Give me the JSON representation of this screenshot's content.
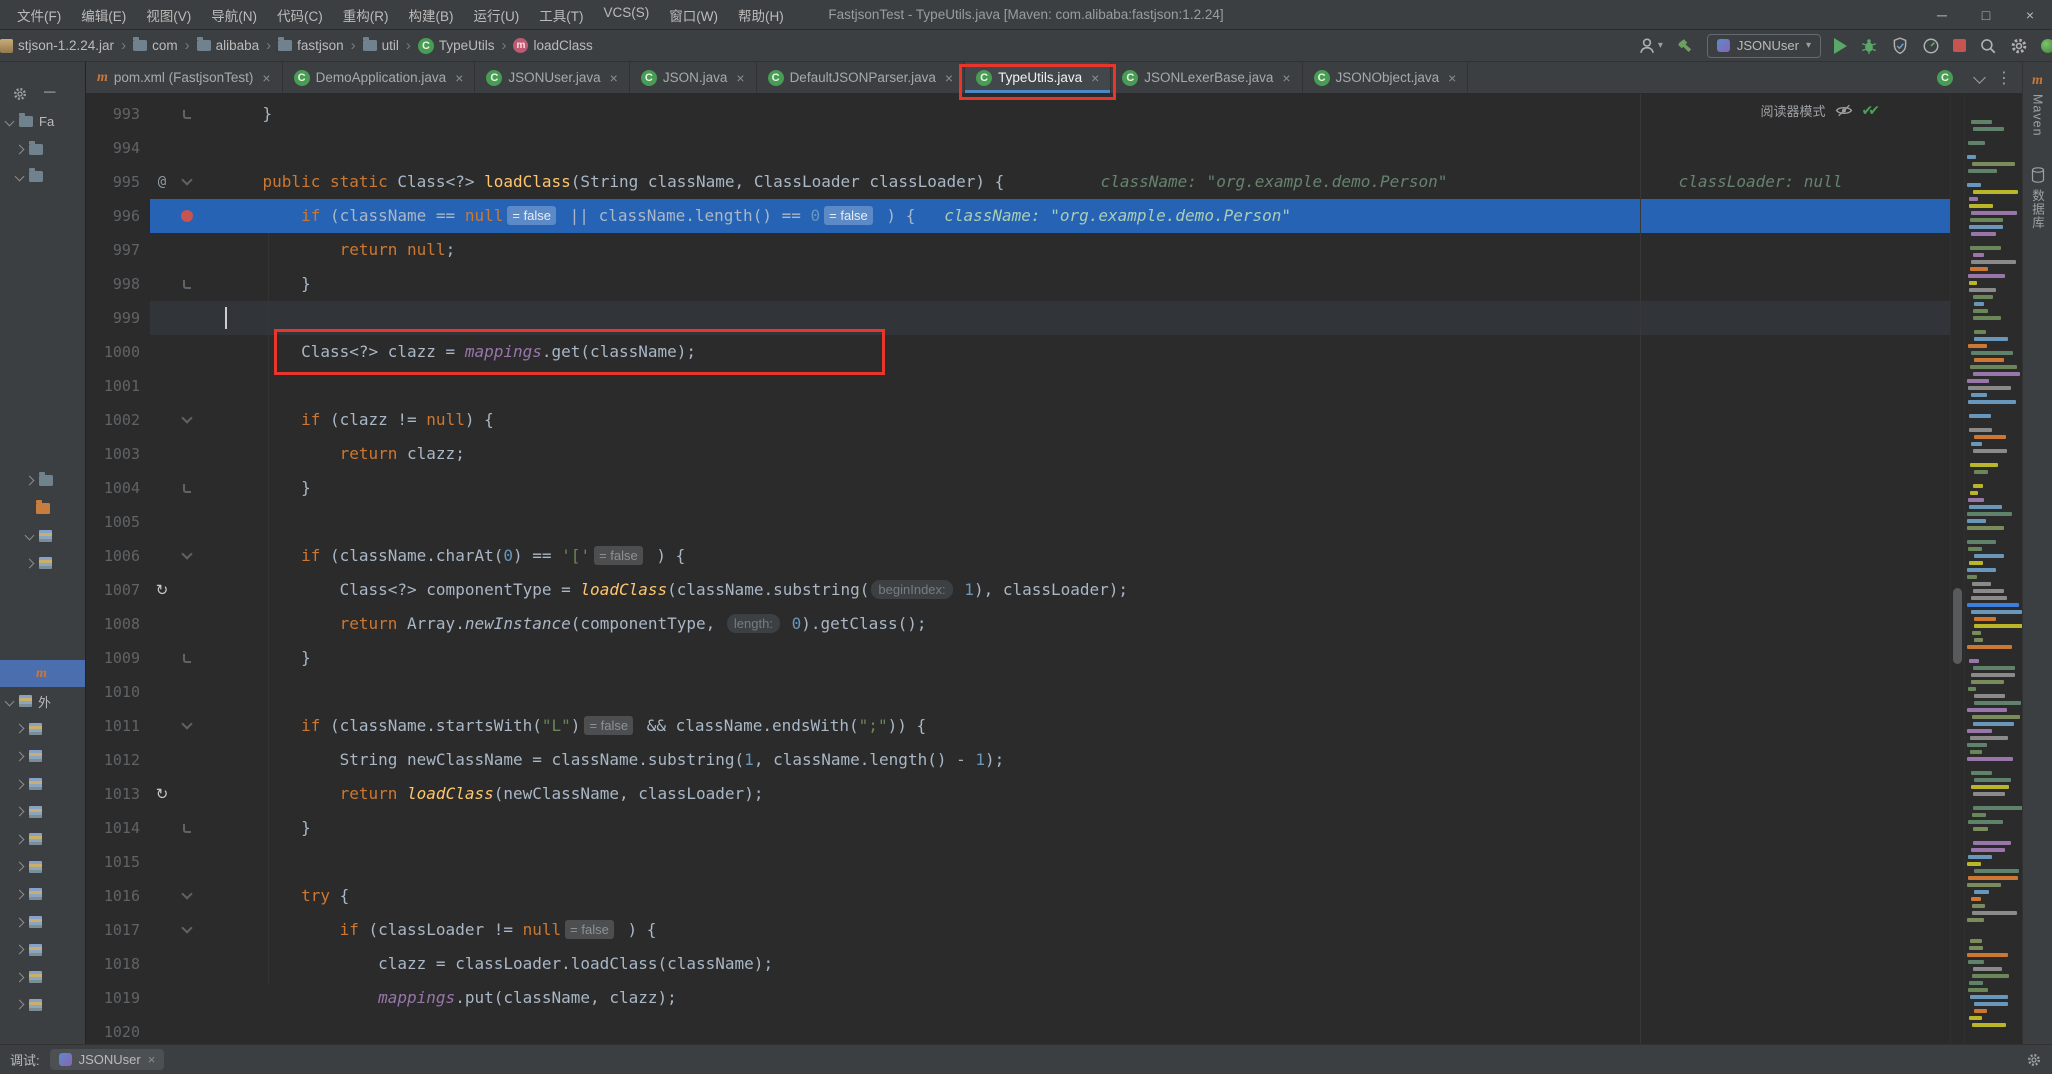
{
  "colors": {
    "annotation": "#E8362D",
    "exec_line": "#2663B5",
    "selection": "#4B6EAF",
    "accent_green": "#59A869",
    "stop_red": "#C75450"
  },
  "icons": {
    "close": "×",
    "chevron": "›",
    "dropdown": "▾",
    "kebab": "⋮",
    "minimize": "─",
    "maximize": "□",
    "close_window": "×",
    "at": "@",
    "recursion": "↻",
    "checks": "✔✔",
    "minus": "─"
  },
  "window": {
    "title": "FastjsonTest - TypeUtils.java [Maven: com.alibaba:fastjson:1.2.24]",
    "menus": [
      "文件(F)",
      "编辑(E)",
      "视图(V)",
      "导航(N)",
      "代码(C)",
      "重构(R)",
      "构建(B)",
      "运行(U)",
      "工具(T)",
      "VCS(S)",
      "窗口(W)",
      "帮助(H)"
    ],
    "controls": {
      "minimize": "─",
      "maximize": "□",
      "close": "×"
    }
  },
  "navbar": {
    "breadcrumbs": [
      {
        "label": "stjson-1.2.24.jar",
        "icon": "jar"
      },
      {
        "label": "com",
        "icon": "folder"
      },
      {
        "label": "alibaba",
        "icon": "folder"
      },
      {
        "label": "fastjson",
        "icon": "folder"
      },
      {
        "label": "util",
        "icon": "folder"
      },
      {
        "label": "TypeUtils",
        "icon": "class"
      },
      {
        "label": "loadClass",
        "icon": "method"
      }
    ],
    "run_config": "JSONUser"
  },
  "tabs": [
    {
      "label": "pom.xml (FastjsonTest)",
      "icon": "maven"
    },
    {
      "label": "DemoApplication.java",
      "icon": "class"
    },
    {
      "label": "JSONUser.java",
      "icon": "class"
    },
    {
      "label": "JSON.java",
      "icon": "class"
    },
    {
      "label": "DefaultJSONParser.java",
      "icon": "class"
    },
    {
      "label": "TypeUtils.java",
      "icon": "class",
      "selected": true,
      "annotated": true
    },
    {
      "label": "JSONLexerBase.java",
      "icon": "class"
    },
    {
      "label": "JSONObject.java",
      "icon": "class"
    }
  ],
  "reader_mode": {
    "label": "阅读器模式"
  },
  "project": {
    "rows": [
      {
        "ch": "v",
        "icon": "folder",
        "label": "Fa"
      },
      {
        "ch": ">",
        "icon": "folder",
        "ind": 1
      },
      {
        "ch": "v",
        "icon": "folder",
        "ind": 1
      },
      {},
      {},
      {},
      {},
      {},
      {},
      {},
      {},
      {},
      {},
      {
        "ch": ">",
        "icon": "folder",
        "ind": 2
      },
      {
        "icon": "folder-orange",
        "ind": 3
      },
      {
        "ch": "v",
        "icon": "lib",
        "ind": 2
      },
      {
        "ch": ">",
        "icon": "lib",
        "ind": 2
      },
      {},
      {},
      {},
      {
        "icon": "maven",
        "ind": 3,
        "sel": true
      },
      {
        "ch": "v",
        "icon": "lib",
        "label": "外"
      },
      {
        "ch": ">",
        "icon": "lib",
        "ind": 1
      },
      {
        "ch": ">",
        "icon": "lib",
        "ind": 1
      },
      {
        "ch": ">",
        "icon": "lib",
        "ind": 1
      },
      {
        "ch": ">",
        "icon": "lib",
        "ind": 1
      },
      {
        "ch": ">",
        "icon": "lib",
        "ind": 1
      },
      {
        "ch": ">",
        "icon": "lib",
        "ind": 1
      },
      {
        "ch": ">",
        "icon": "lib",
        "ind": 1
      },
      {
        "ch": ">",
        "icon": "lib",
        "ind": 1
      },
      {
        "ch": ">",
        "icon": "lib",
        "ind": 1
      },
      {
        "ch": ">",
        "icon": "lib",
        "ind": 1
      },
      {
        "ch": ">",
        "icon": "lib",
        "ind": 1
      }
    ]
  },
  "editor": {
    "exec_line": "996",
    "caret_line": "999",
    "lines": [
      {
        "no": "993",
        "g": "fold-end",
        "segs": [
          {
            "t": "    }",
            "c": "d"
          }
        ]
      },
      {
        "no": "994",
        "segs": []
      },
      {
        "no": "995",
        "g": "fold-open",
        "g2": "at",
        "segs": [
          {
            "t": "    ",
            "c": "d"
          },
          {
            "t": "public",
            "c": "k"
          },
          {
            "t": " ",
            "c": "d"
          },
          {
            "t": "static",
            "c": "k"
          },
          {
            "t": " Class<?> ",
            "c": "d"
          },
          {
            "t": "loadClass",
            "c": "m"
          },
          {
            "t": "(String className, ClassLoader classLoader) {",
            "c": "d"
          },
          {
            "t": "          className: \"org.example.demo.Person\"",
            "c": "dbg"
          },
          {
            "t": "                        classLoader: null",
            "c": "dbg"
          }
        ]
      },
      {
        "no": "996",
        "g": "breakpoint",
        "exec": true,
        "segs": [
          {
            "t": "        ",
            "c": "d"
          },
          {
            "t": "if",
            "c": "k"
          },
          {
            "t": " (className == ",
            "c": "d"
          },
          {
            "t": "null",
            "c": "k"
          },
          {
            "t": "= false",
            "c": "b"
          },
          {
            "t": " || className.length() == ",
            "c": "d"
          },
          {
            "t": "0",
            "c": "n"
          },
          {
            "t": "= false",
            "c": "b"
          },
          {
            "t": " ) {",
            "c": "d"
          },
          {
            "t": "   className: \"org.example.demo.Person\"",
            "c": "dbg"
          }
        ]
      },
      {
        "no": "997",
        "segs": [
          {
            "t": "            ",
            "c": "d"
          },
          {
            "t": "return",
            "c": "k"
          },
          {
            "t": " ",
            "c": "d"
          },
          {
            "t": "null",
            "c": "k"
          },
          {
            "t": ";",
            "c": "d"
          }
        ]
      },
      {
        "no": "998",
        "g": "fold-end",
        "segs": [
          {
            "t": "        }",
            "c": "d"
          }
        ]
      },
      {
        "no": "999",
        "caret": true,
        "segs": []
      },
      {
        "no": "1000",
        "segs": [
          {
            "t": "        Class<?> clazz = ",
            "c": "d"
          },
          {
            "t": "mappings",
            "c": "f"
          },
          {
            "t": ".get(className);",
            "c": "d"
          }
        ]
      },
      {
        "no": "1001",
        "segs": []
      },
      {
        "no": "1002",
        "g": "fold-open",
        "segs": [
          {
            "t": "        ",
            "c": "d"
          },
          {
            "t": "if",
            "c": "k"
          },
          {
            "t": " (clazz != ",
            "c": "d"
          },
          {
            "t": "null",
            "c": "k"
          },
          {
            "t": ") {",
            "c": "d"
          }
        ]
      },
      {
        "no": "1003",
        "segs": [
          {
            "t": "            ",
            "c": "d"
          },
          {
            "t": "return",
            "c": "k"
          },
          {
            "t": " clazz;",
            "c": "d"
          }
        ]
      },
      {
        "no": "1004",
        "g": "fold-end",
        "segs": [
          {
            "t": "        }",
            "c": "d"
          }
        ]
      },
      {
        "no": "1005",
        "segs": []
      },
      {
        "no": "1006",
        "g": "fold-open",
        "segs": [
          {
            "t": "        ",
            "c": "d"
          },
          {
            "t": "if",
            "c": "k"
          },
          {
            "t": " (className.charAt(",
            "c": "d"
          },
          {
            "t": "0",
            "c": "n"
          },
          {
            "t": ") == ",
            "c": "d"
          },
          {
            "t": "'['",
            "c": "s"
          },
          {
            "t": "= false",
            "c": "b"
          },
          {
            "t": " ) {",
            "c": "d"
          }
        ]
      },
      {
        "no": "1007",
        "g2": "recursion",
        "segs": [
          {
            "t": "            Class<?> componentType = ",
            "c": "d"
          },
          {
            "t": "loadClass",
            "c": "mi"
          },
          {
            "t": "(className.substring(",
            "c": "d"
          },
          {
            "t": "beginIndex:",
            "c": "p"
          },
          {
            "t": " ",
            "c": "d"
          },
          {
            "t": "1",
            "c": "n"
          },
          {
            "t": "), classLoader);",
            "c": "d"
          }
        ]
      },
      {
        "no": "1008",
        "segs": [
          {
            "t": "            ",
            "c": "d"
          },
          {
            "t": "return",
            "c": "k"
          },
          {
            "t": " Array.",
            "c": "d"
          },
          {
            "t": "newInstance",
            "c": "di"
          },
          {
            "t": "(componentType, ",
            "c": "d"
          },
          {
            "t": "length:",
            "c": "p"
          },
          {
            "t": " ",
            "c": "d"
          },
          {
            "t": "0",
            "c": "n"
          },
          {
            "t": ").getClass();",
            "c": "d"
          }
        ]
      },
      {
        "no": "1009",
        "g": "fold-end",
        "segs": [
          {
            "t": "        }",
            "c": "d"
          }
        ]
      },
      {
        "no": "1010",
        "segs": []
      },
      {
        "no": "1011",
        "g": "fold-open",
        "segs": [
          {
            "t": "        ",
            "c": "d"
          },
          {
            "t": "if",
            "c": "k"
          },
          {
            "t": " (className.startsWith(",
            "c": "d"
          },
          {
            "t": "\"L\"",
            "c": "s"
          },
          {
            "t": ")",
            "c": "d"
          },
          {
            "t": "= false",
            "c": "b"
          },
          {
            "t": " && className.endsWith(",
            "c": "d"
          },
          {
            "t": "\";\"",
            "c": "s"
          },
          {
            "t": ")) {",
            "c": "d"
          }
        ]
      },
      {
        "no": "1012",
        "segs": [
          {
            "t": "            String newClassName = className.substring(",
            "c": "d"
          },
          {
            "t": "1",
            "c": "n"
          },
          {
            "t": ", className.length() - ",
            "c": "d"
          },
          {
            "t": "1",
            "c": "n"
          },
          {
            "t": ");",
            "c": "d"
          }
        ]
      },
      {
        "no": "1013",
        "g2": "recursion",
        "segs": [
          {
            "t": "            ",
            "c": "d"
          },
          {
            "t": "return",
            "c": "k"
          },
          {
            "t": " ",
            "c": "d"
          },
          {
            "t": "loadClass",
            "c": "mi"
          },
          {
            "t": "(newClassName, classLoader);",
            "c": "d"
          }
        ]
      },
      {
        "no": "1014",
        "g": "fold-end",
        "segs": [
          {
            "t": "        }",
            "c": "d"
          }
        ]
      },
      {
        "no": "1015",
        "segs": []
      },
      {
        "no": "1016",
        "g": "fold-open",
        "segs": [
          {
            "t": "        ",
            "c": "d"
          },
          {
            "t": "try",
            "c": "k"
          },
          {
            "t": " {",
            "c": "d"
          }
        ]
      },
      {
        "no": "1017",
        "g": "fold-open",
        "segs": [
          {
            "t": "            ",
            "c": "d"
          },
          {
            "t": "if",
            "c": "k"
          },
          {
            "t": " (classLoader != ",
            "c": "d"
          },
          {
            "t": "null",
            "c": "k"
          },
          {
            "t": "= false",
            "c": "b"
          },
          {
            "t": " ) {",
            "c": "d"
          }
        ]
      },
      {
        "no": "1018",
        "segs": [
          {
            "t": "                clazz = classLoader.loadClass(className);",
            "c": "d"
          }
        ]
      },
      {
        "no": "1019",
        "segs": [
          {
            "t": "                ",
            "c": "d"
          },
          {
            "t": "mappings",
            "c": "f"
          },
          {
            "t": ".put(className, clazz);",
            "c": "d"
          }
        ]
      },
      {
        "no": "1020",
        "segs": []
      }
    ]
  },
  "minimap": {
    "palette": [
      "#7A8B5C",
      "#9876AA",
      "#6A8759",
      "#CC7832",
      "#8A8A8A",
      "#6897BB",
      "#BBB529",
      "#5F826B"
    ]
  },
  "right_stripe": [
    {
      "id": "maven",
      "icon": "maven",
      "label": "Maven"
    },
    {
      "id": "database",
      "icon": "database",
      "label": "数据库"
    }
  ],
  "bottom": {
    "debug_label": "调试:",
    "tab_label": "JSONUser"
  }
}
